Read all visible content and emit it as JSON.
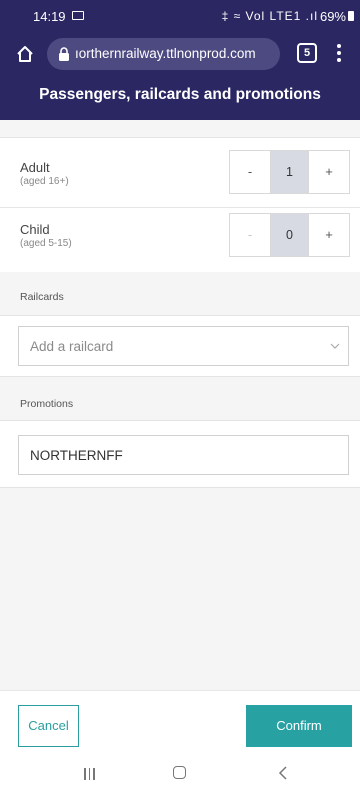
{
  "status_bar": {
    "time": "14:19",
    "icons_text": "‡ ≈ Vol LTE1 .ıl",
    "battery": "69%"
  },
  "browser": {
    "url": "ıorthernrailway.ttlnonprod.com",
    "tab_count": "5"
  },
  "page": {
    "title": "Passengers, railcards and promotions"
  },
  "passengers": [
    {
      "name": "Adult",
      "age": "(aged 16+)",
      "count": "1",
      "minus": "-",
      "plus": "+"
    },
    {
      "name": "Child",
      "age": "(aged 5-15)",
      "count": "0",
      "minus": "-",
      "plus": "+"
    }
  ],
  "railcards": {
    "section_label": "Railcards",
    "placeholder": "Add a railcard"
  },
  "promotions": {
    "section_label": "Promotions",
    "value": "NORTHERNFF"
  },
  "footer": {
    "cancel_label": "Cancel",
    "confirm_label": "Confirm"
  },
  "colors": {
    "header_bg": "#2b2762",
    "accent": "#28a1a3",
    "stepper_value_bg": "#d7dae3"
  }
}
